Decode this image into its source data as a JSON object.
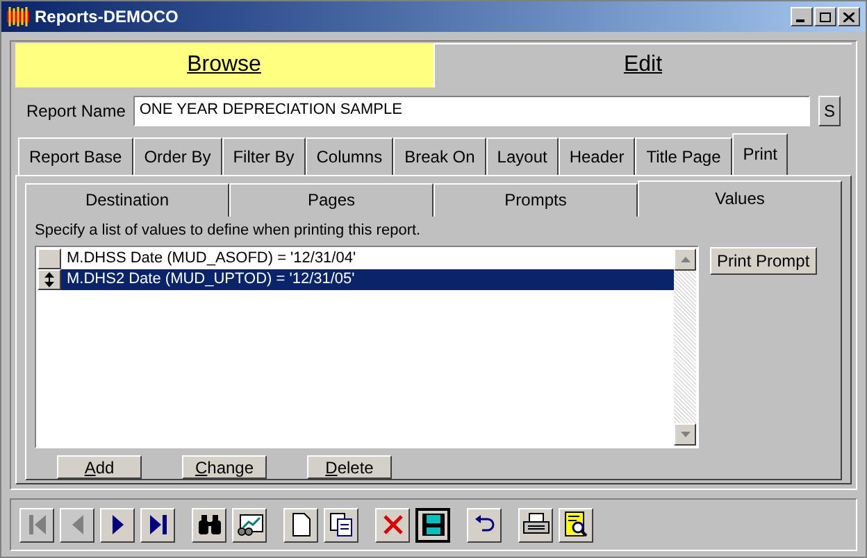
{
  "window": {
    "title": "Reports-DEMOCO"
  },
  "mode_tabs": [
    {
      "label": "Browse",
      "selected": true
    },
    {
      "label": "Edit",
      "selected": false
    }
  ],
  "report_name": {
    "label": "Report Name",
    "value": "ONE YEAR DEPRECIATION SAMPLE",
    "side_button": "S"
  },
  "tabs": [
    {
      "label": "Report Base",
      "selected": false
    },
    {
      "label": "Order By",
      "selected": false
    },
    {
      "label": "Filter By",
      "selected": false
    },
    {
      "label": "Columns",
      "selected": false
    },
    {
      "label": "Break On",
      "selected": false
    },
    {
      "label": "Layout",
      "selected": false
    },
    {
      "label": "Header",
      "selected": false
    },
    {
      "label": "Title Page",
      "selected": false
    },
    {
      "label": "Print",
      "selected": true
    }
  ],
  "subtabs": [
    {
      "label": "Destination",
      "selected": false
    },
    {
      "label": "Pages",
      "selected": false
    },
    {
      "label": "Prompts",
      "selected": false
    },
    {
      "label": "Values",
      "selected": true
    }
  ],
  "instructions": "Specify a list of values to define when printing this report.",
  "values_list": [
    {
      "text": "M.DHSS Date (MUD_ASOFD) = '12/31/04'",
      "selected": false
    },
    {
      "text": "M.DHS2 Date (MUD_UPTOD) = '12/31/05'",
      "selected": true
    }
  ],
  "print_prompt_button": "Print Prompt",
  "list_buttons": [
    "Add",
    "Change",
    "Delete"
  ],
  "toolbar": [
    {
      "kind": "first",
      "disabled": true
    },
    {
      "kind": "prev",
      "disabled": true
    },
    {
      "kind": "next",
      "disabled": false
    },
    {
      "kind": "last",
      "disabled": false
    },
    {
      "kind": "find",
      "disabled": false
    },
    {
      "kind": "report",
      "disabled": false
    },
    {
      "kind": "new",
      "disabled": false
    },
    {
      "kind": "copy",
      "disabled": false
    },
    {
      "kind": "delete",
      "disabled": false
    },
    {
      "kind": "save",
      "disabled": false
    },
    {
      "kind": "undo",
      "disabled": false
    },
    {
      "kind": "print",
      "disabled": false
    },
    {
      "kind": "preview",
      "disabled": false
    }
  ]
}
